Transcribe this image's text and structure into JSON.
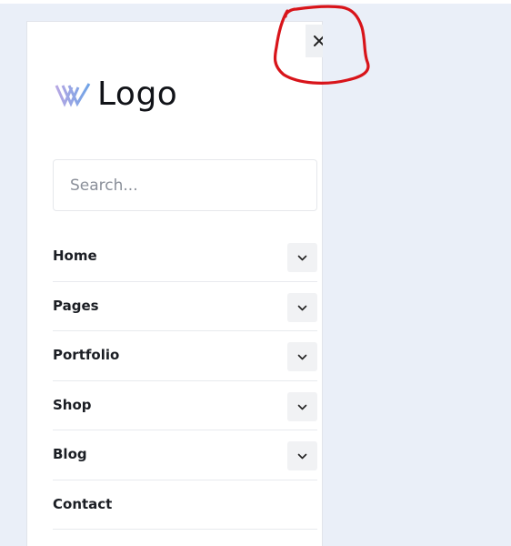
{
  "logo": {
    "text": "Logo"
  },
  "search": {
    "placeholder": "Search..."
  },
  "nav": {
    "items": [
      {
        "label": "Home",
        "has_submenu": true
      },
      {
        "label": "Pages",
        "has_submenu": true
      },
      {
        "label": "Portfolio",
        "has_submenu": true
      },
      {
        "label": "Shop",
        "has_submenu": true
      },
      {
        "label": "Blog",
        "has_submenu": true
      },
      {
        "label": "Contact",
        "has_submenu": false
      }
    ]
  },
  "icons": {
    "close": "close-icon",
    "toggle": "chevron-down-icon",
    "logo": "logo-mark-icon"
  },
  "colors": {
    "backdrop": "#eaeff8",
    "annotation": "#d8141a",
    "logo_gradient_start": "#b7a7e3",
    "logo_gradient_end": "#6fa3e6",
    "text": "#1b1e24"
  }
}
